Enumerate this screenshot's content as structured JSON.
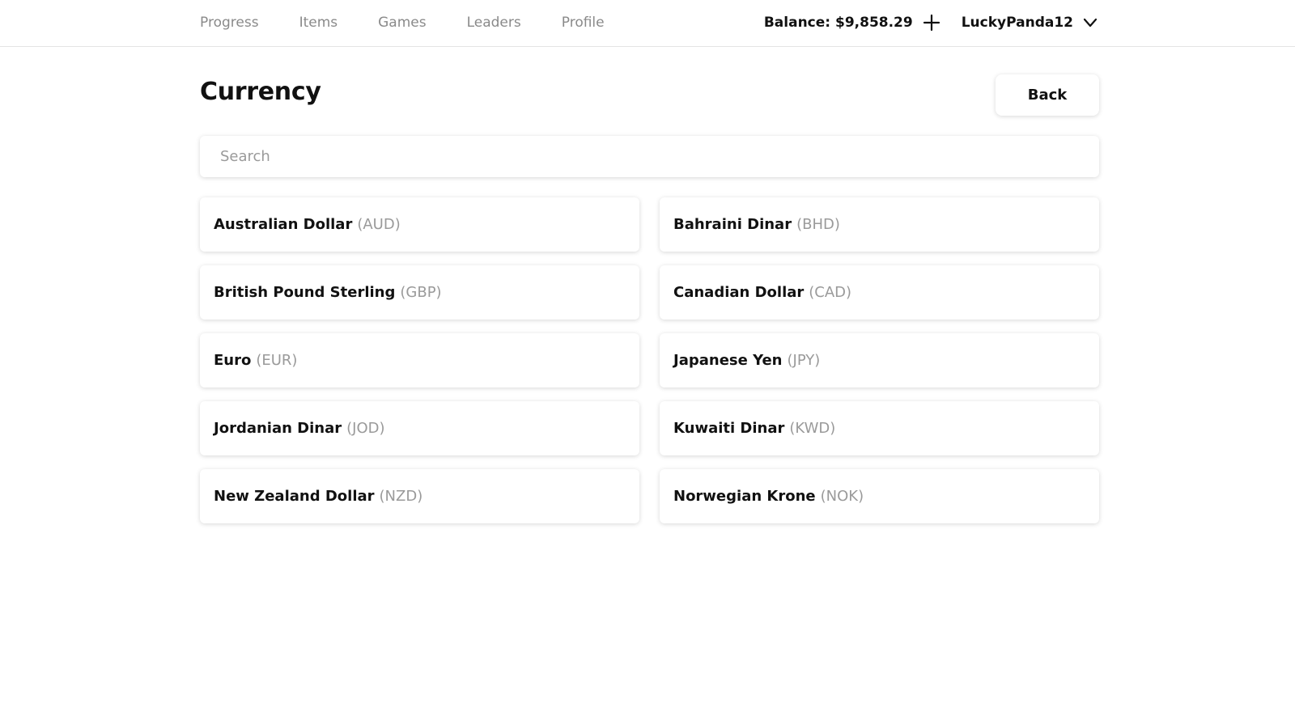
{
  "nav": {
    "items": [
      {
        "label": "Progress"
      },
      {
        "label": "Items"
      },
      {
        "label": "Games"
      },
      {
        "label": "Leaders"
      },
      {
        "label": "Profile"
      }
    ]
  },
  "account": {
    "balance_label": "Balance: $9,858.29",
    "username": "LuckyPanda12"
  },
  "page": {
    "title": "Currency",
    "back_label": "Back"
  },
  "search": {
    "placeholder": "Search",
    "value": ""
  },
  "currencies": [
    {
      "name": "Australian Dollar",
      "code": "(AUD)"
    },
    {
      "name": "Bahraini Dinar",
      "code": "(BHD)"
    },
    {
      "name": "British Pound Sterling",
      "code": "(GBP)"
    },
    {
      "name": "Canadian Dollar",
      "code": "(CAD)"
    },
    {
      "name": "Euro",
      "code": "(EUR)"
    },
    {
      "name": "Japanese Yen",
      "code": "(JPY)"
    },
    {
      "name": "Jordanian Dinar",
      "code": "(JOD)"
    },
    {
      "name": "Kuwaiti Dinar",
      "code": "(KWD)"
    },
    {
      "name": "New Zealand Dollar",
      "code": "(NZD)"
    },
    {
      "name": "Norwegian Krone",
      "code": "(NOK)"
    }
  ],
  "icons": {
    "add": "plus-icon",
    "menu": "chevron-down-icon"
  },
  "colors": {
    "text": "#111111",
    "muted": "#8a8a8a",
    "code": "#9a9a9a",
    "background": "#ffffff"
  }
}
